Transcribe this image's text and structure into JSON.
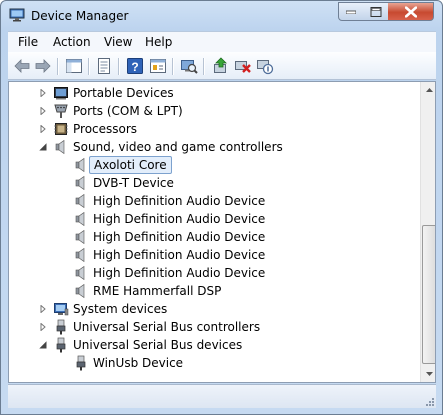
{
  "window": {
    "title": "Device Manager",
    "icon": "device-manager-icon"
  },
  "menu": [
    "File",
    "Action",
    "View",
    "Help"
  ],
  "toolbar": {
    "buttons": [
      "back-arrow-icon",
      "forward-arrow-icon",
      "console-tree-icon",
      "properties-sheet-icon",
      "help-icon",
      "properties-icon",
      "scan-hardware-icon",
      "update-driver-icon",
      "uninstall-icon",
      "disable-icon"
    ]
  },
  "tree": {
    "items": [
      {
        "label": "Portable Devices",
        "icon": "portable-devices-icon",
        "expanded": false
      },
      {
        "label": "Ports (COM & LPT)",
        "icon": "ports-icon",
        "expanded": false
      },
      {
        "label": "Processors",
        "icon": "processor-icon",
        "expanded": false
      },
      {
        "label": "Sound, video and game controllers",
        "icon": "speaker-icon",
        "expanded": true
      },
      {
        "label": "Axoloti Core",
        "icon": "speaker-icon",
        "selected": true
      },
      {
        "label": "DVB-T Device",
        "icon": "speaker-icon"
      },
      {
        "label": "High Definition Audio Device",
        "icon": "speaker-icon"
      },
      {
        "label": "High Definition Audio Device",
        "icon": "speaker-icon"
      },
      {
        "label": "High Definition Audio Device",
        "icon": "speaker-icon"
      },
      {
        "label": "High Definition Audio Device",
        "icon": "speaker-icon"
      },
      {
        "label": "High Definition Audio Device",
        "icon": "speaker-icon"
      },
      {
        "label": "RME Hammerfall DSP",
        "icon": "speaker-icon"
      },
      {
        "label": "System devices",
        "icon": "system-devices-icon",
        "expanded": false
      },
      {
        "label": "Universal Serial Bus controllers",
        "icon": "usb-icon",
        "expanded": false
      },
      {
        "label": "Universal Serial Bus devices",
        "icon": "usb-icon",
        "expanded": true
      },
      {
        "label": "WinUsb Device",
        "icon": "usb-icon"
      }
    ]
  },
  "colors": {
    "selection_border": "#7da2ce",
    "selection_fill": "#e3eefb",
    "title_gradient": "#cfe1f5"
  }
}
